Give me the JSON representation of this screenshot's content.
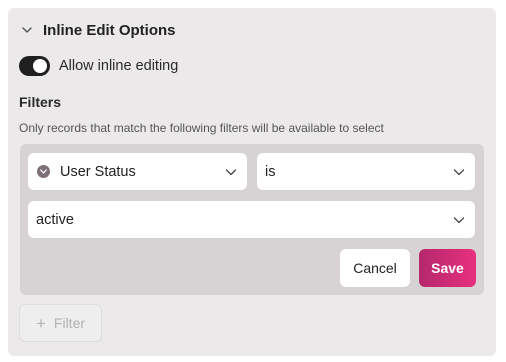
{
  "section": {
    "title": "Inline Edit Options",
    "toggle_label": "Allow inline editing",
    "toggle_on": true
  },
  "filters": {
    "heading": "Filters",
    "help_text": "Only records that match the following filters will be available to select",
    "rule": {
      "field": "User Status",
      "operator": "is",
      "value": "active"
    },
    "cancel_label": "Cancel",
    "save_label": "Save",
    "add_filter_label": "Filter"
  },
  "colors": {
    "save_gradient_start": "#b4286c",
    "save_gradient_end": "#e7307e",
    "toggle_on": "#1f1f1f",
    "panel_bg": "#ebe9ea",
    "filter_box_bg": "#d7d3d5"
  },
  "icons": {
    "section_toggle": "chevron-down-icon",
    "field_type": "status-icon",
    "dropdown": "chevron-down-icon",
    "add": "plus-icon"
  }
}
